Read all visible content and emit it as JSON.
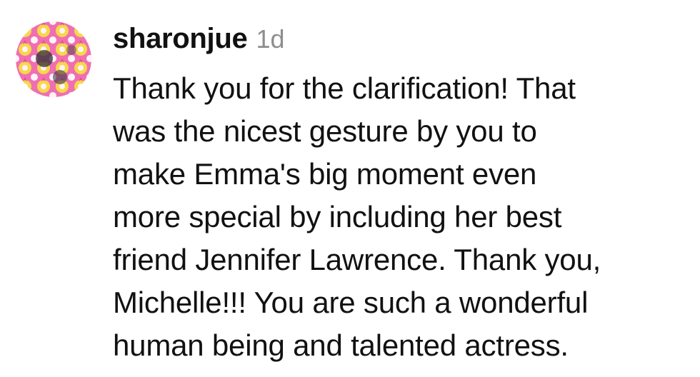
{
  "comment": {
    "username": "sharonjue",
    "timestamp": "1d",
    "avatar_icon": "patterned-avatar-icon",
    "colors": {
      "username": "#111111",
      "timestamp": "#8e8e8e",
      "text": "#111111",
      "avatar_pink": "#f06fb0",
      "avatar_yellow": "#f6d84a",
      "avatar_white": "#fff3f8"
    },
    "lines": [
      "Thank you for the clarification! That",
      "was the nicest gesture by you to",
      "make Emma's big moment even",
      "more special by including her best",
      "friend Jennifer Lawrence. Thank you,",
      "Michelle!!! You are such a wonderful",
      "human being and talented actress."
    ]
  }
}
